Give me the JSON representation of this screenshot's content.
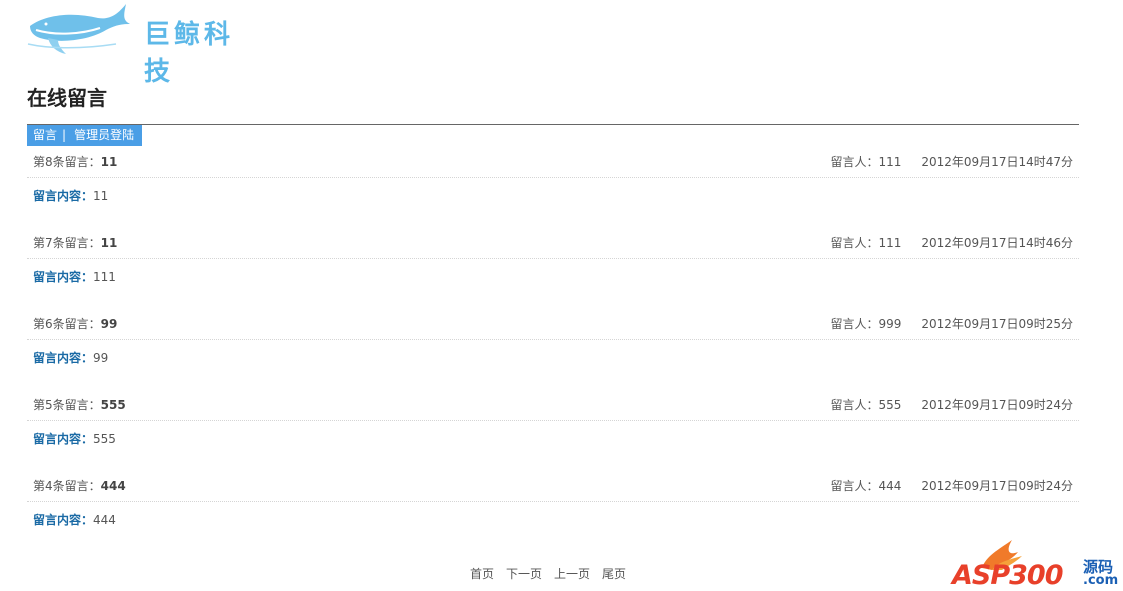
{
  "header": {
    "logo_text": "巨鲸科技",
    "page_title": "在线留言"
  },
  "nav": {
    "items": [
      {
        "label": "留言"
      },
      {
        "label": "管理员登陆"
      }
    ],
    "separator": "|"
  },
  "entries": [
    {
      "number_label": "第8条留言：",
      "title": "11",
      "author_label": "留言人：",
      "author": "111",
      "datetime": "2012年09月17日14时47分",
      "content_label": "留言内容：",
      "content": "11"
    },
    {
      "number_label": "第7条留言：",
      "title": "11",
      "author_label": "留言人：",
      "author": "111",
      "datetime": "2012年09月17日14时46分",
      "content_label": "留言内容：",
      "content": "111"
    },
    {
      "number_label": "第6条留言：",
      "title": "99",
      "author_label": "留言人：",
      "author": "999",
      "datetime": "2012年09月17日09时25分",
      "content_label": "留言内容：",
      "content": "99"
    },
    {
      "number_label": "第5条留言：",
      "title": "555",
      "author_label": "留言人：",
      "author": "555",
      "datetime": "2012年09月17日09时24分",
      "content_label": "留言内容：",
      "content": "555"
    },
    {
      "number_label": "第4条留言：",
      "title": "444",
      "author_label": "留言人：",
      "author": "444",
      "datetime": "2012年09月17日09时24分",
      "content_label": "留言内容：",
      "content": "444"
    }
  ],
  "pager": {
    "first": "首页",
    "next": "下一页",
    "prev": "上一页",
    "last": "尾页"
  },
  "watermark": {
    "text_main": "ASP300",
    "text_side": "源码",
    "text_dom": ".com"
  },
  "colors": {
    "nav_bg": "#4a9ee6",
    "logo": "#5db8e8",
    "label_blue": "#1a6aa5",
    "watermark_red": "#e8402a"
  }
}
